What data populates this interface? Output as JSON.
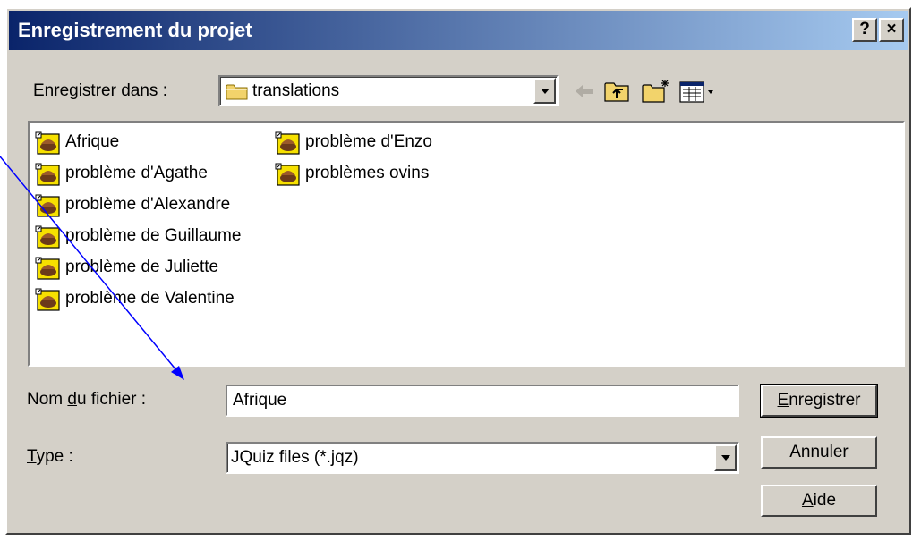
{
  "window": {
    "title": "Enregistrement du projet",
    "help_label": "?",
    "close_label": "×"
  },
  "save_in": {
    "label_before": "Enregistrer ",
    "label_accel": "d",
    "label_after": "ans :",
    "value": "translations"
  },
  "files": [
    {
      "name": "Afrique"
    },
    {
      "name": "problème d'Agathe"
    },
    {
      "name": "problème d'Alexandre"
    },
    {
      "name": "problème de Guillaume"
    },
    {
      "name": "problème de Juliette"
    },
    {
      "name": "problème de Valentine"
    },
    {
      "name": "problème d'Enzo"
    },
    {
      "name": "problèmes ovins"
    }
  ],
  "filename": {
    "label_before": "Nom ",
    "label_accel": "d",
    "label_after": "u fichier :",
    "value": "Afrique"
  },
  "type": {
    "label_accel": "T",
    "label_after": "ype :",
    "value": "JQuiz files (*.jqz)"
  },
  "buttons": {
    "save_accel": "E",
    "save_rest": "nregistrer",
    "cancel": "Annuler",
    "help_accel": "A",
    "help_rest": "ide"
  },
  "colors": {
    "title_start": "#0a246a",
    "title_end": "#a6caf0",
    "dialog_face": "#d4d0c8",
    "arrow": "#0000ff"
  }
}
